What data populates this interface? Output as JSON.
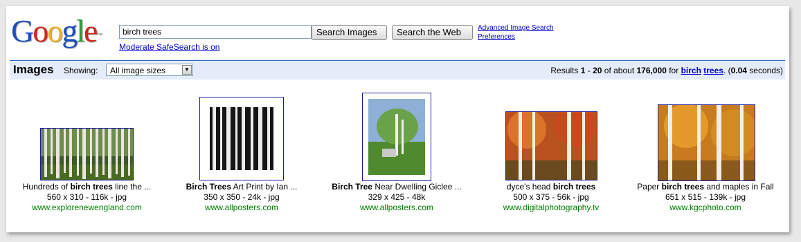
{
  "logo": {
    "letters": [
      "G",
      "o",
      "o",
      "g",
      "l",
      "e"
    ],
    "colors": [
      "#1b4fbf",
      "#d4241b",
      "#f0b21a",
      "#1b4fbf",
      "#2e9c34",
      "#d4241b"
    ],
    "tm": "™"
  },
  "search": {
    "value": "birch trees",
    "images_button": "Search Images",
    "web_button": "Search the Web",
    "safesearch": "Moderate SafeSearch is on"
  },
  "links": {
    "advanced": "Advanced Image Search",
    "preferences": "Preferences"
  },
  "bar": {
    "title": "Images",
    "showing_label": "Showing:",
    "size_select": "All image sizes",
    "results": {
      "prefix": "Results ",
      "from": "1",
      "dash": " - ",
      "to": "20",
      "mid": " of about ",
      "total": "176,000",
      "for": " for ",
      "q1": "birch",
      "q2": "trees",
      "dot_paren": ". (",
      "time": "0.04",
      "suffix": " seconds)"
    }
  },
  "results": [
    {
      "title_pre": "Hundreds of ",
      "title_bold": "birch trees",
      "title_post": " line the ...",
      "meta": "560 x 310 - 116k - jpg",
      "url": "www.explorenewengland.com"
    },
    {
      "title_pre": "",
      "title_bold": "Birch Trees",
      "title_post": " Art Print by Ian ...",
      "meta": "350 x 350 - 24k - jpg",
      "url": "www.allposters.com"
    },
    {
      "title_pre": "",
      "title_bold": "Birch Tree",
      "title_post": " Near Dwelling Giclee ...",
      "meta": "329 x 425 - 48k",
      "url": "www.allposters.com"
    },
    {
      "title_pre": "dyce's head ",
      "title_bold": "birch trees",
      "title_post": "",
      "meta": "500 x 375 - 56k - jpg",
      "url": "www.digitalphotography.tv"
    },
    {
      "title_pre": "Paper ",
      "title_bold": "birch trees",
      "title_post": " and maples in Fall",
      "meta": "651 x 515 - 139k - jpg",
      "url": "www.kgcphoto.com"
    }
  ]
}
